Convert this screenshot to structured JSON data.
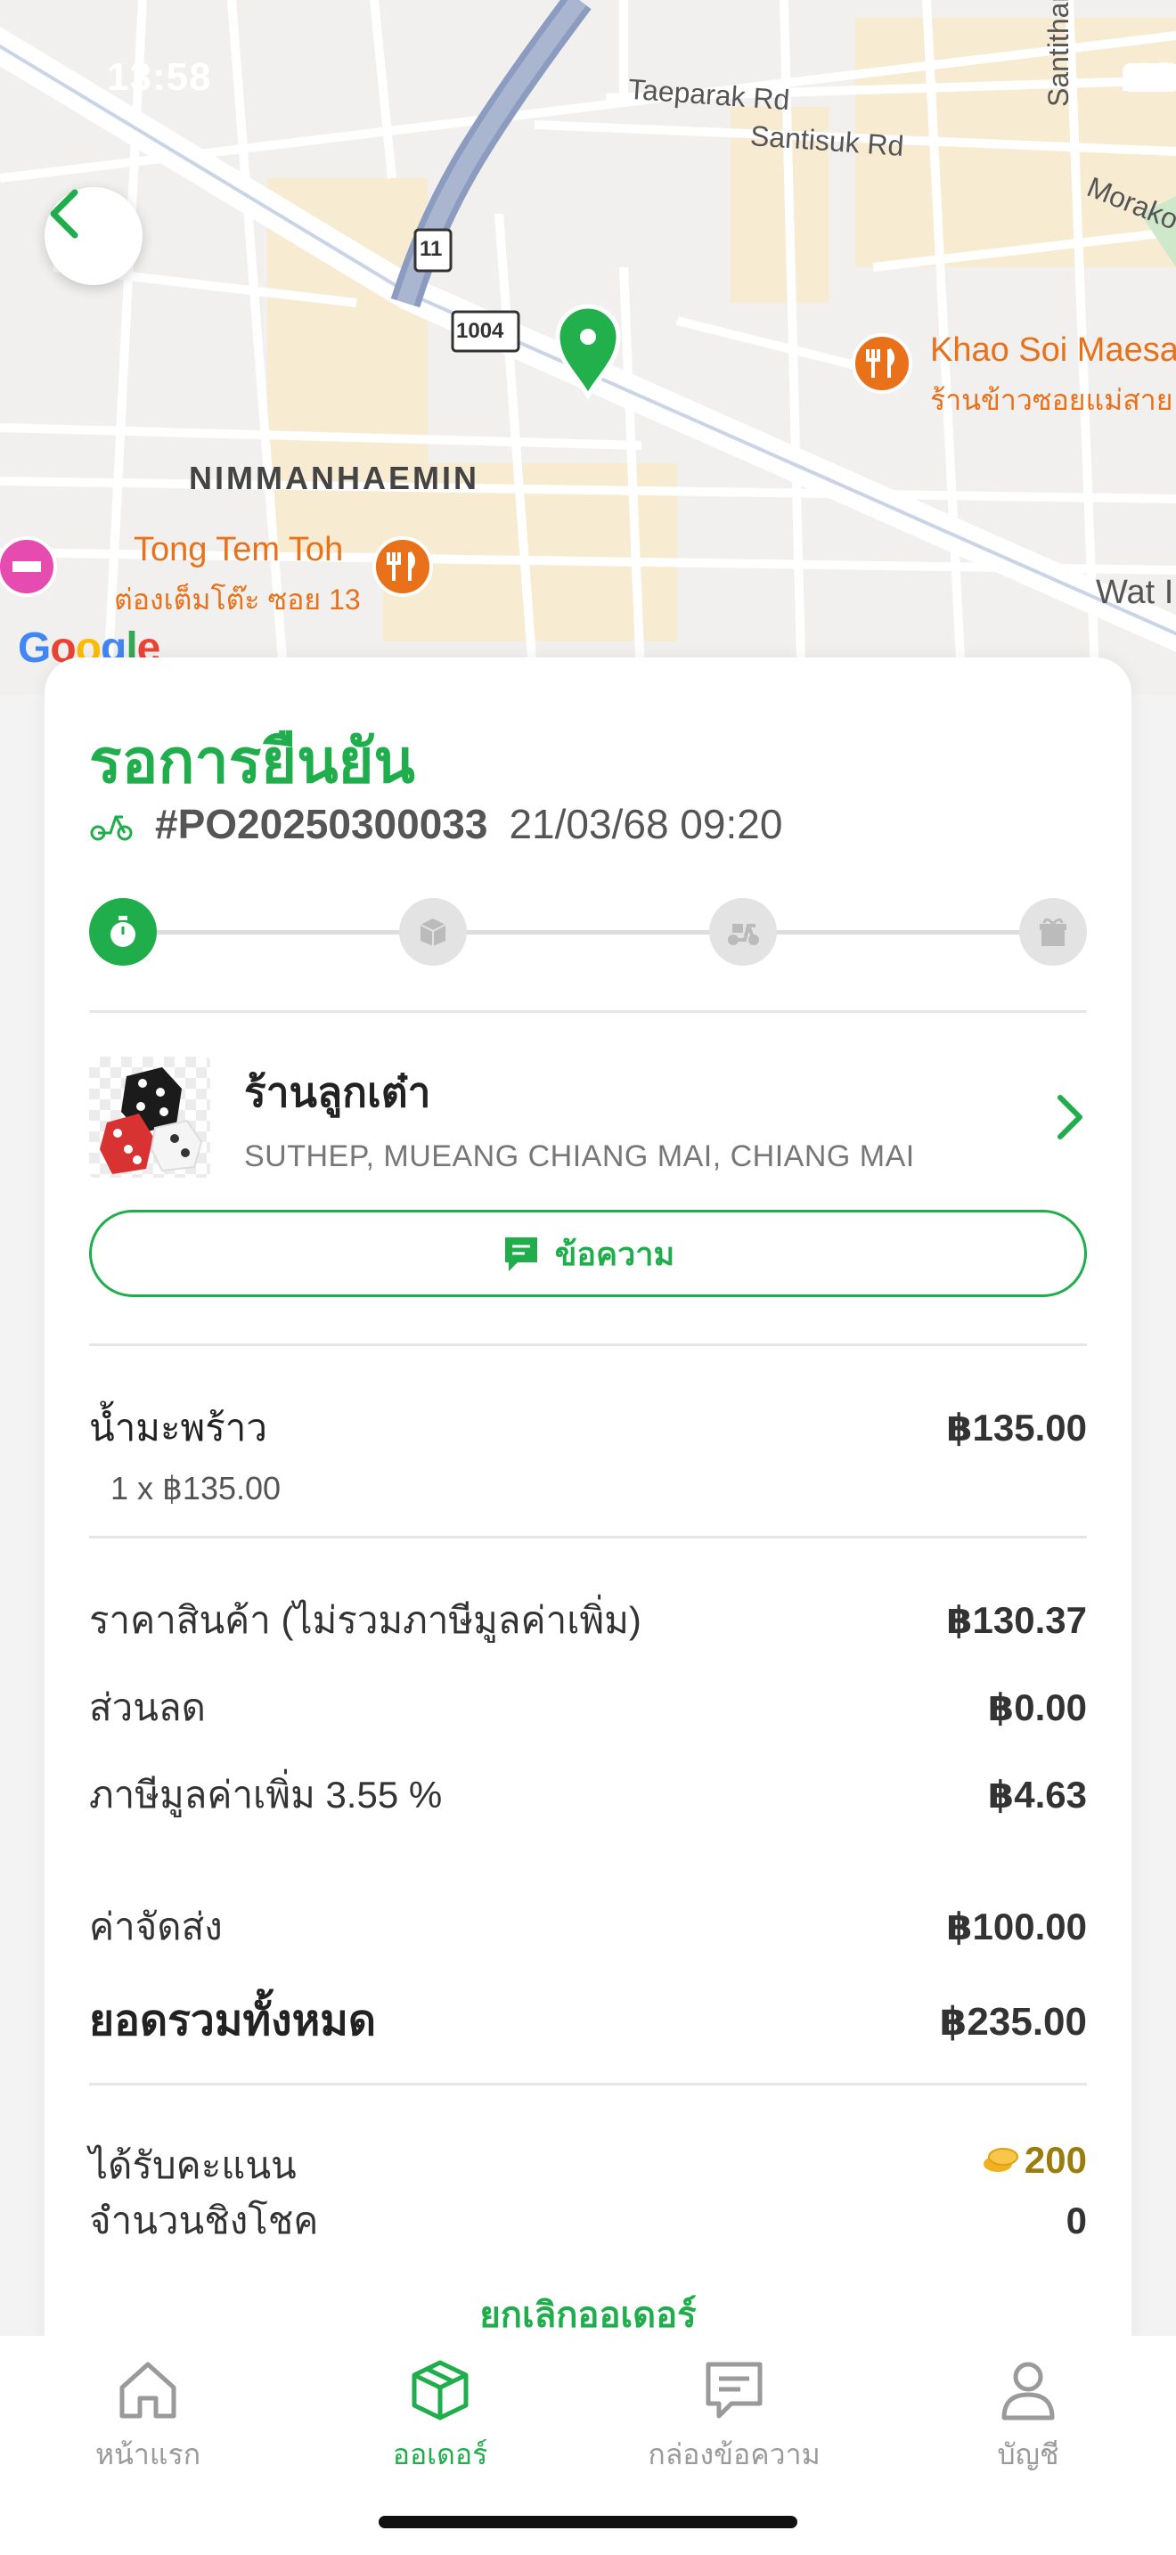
{
  "status_bar": {
    "time": "13:58"
  },
  "map": {
    "roads": [
      "Taeparak Rd",
      "Santisuk Rd",
      "Santitham R",
      "Morako"
    ],
    "route_badges": [
      "11",
      "1004"
    ],
    "area": "NIMMANHAEMIN",
    "pois": [
      {
        "name": "Khao Soi Maesa",
        "name_th": "ร้านข้าวซอยแม่สาย"
      },
      {
        "name": "Tong Tem Toh",
        "name_th": "ต่องเต็มโต๊ะ ซอย 13"
      },
      {
        "name": "Wat I"
      }
    ],
    "attribution": "Google",
    "colors": {
      "pin": "#21b04b",
      "poi": "#e8711a"
    }
  },
  "order": {
    "status": "รอการยืนยัน",
    "number": "#PO20250300033",
    "datetime": "21/03/68 09:20",
    "progress": {
      "steps": [
        "timer-icon",
        "box-icon",
        "delivery-scooter-icon",
        "gift-box-icon"
      ],
      "current_step": 1
    },
    "shop": {
      "name": "ร้านลูกเต๋า",
      "address": "SUTHEP, MUEANG CHIANG MAI, CHIANG MAI"
    },
    "message_button": "ข้อความ",
    "items": [
      {
        "name": "น้ำมะพร้าว",
        "qty_line": "1 x ฿135.00",
        "total": "฿135.00"
      }
    ],
    "summary": {
      "subtotal_label": "ราคาสินค้า (ไม่รวมภาษีมูลค่าเพิ่ม)",
      "subtotal": "฿130.37",
      "discount_label": "ส่วนลด",
      "discount": "฿0.00",
      "vat_label": "ภาษีมูลค่าเพิ่ม 3.55 %",
      "vat": "฿4.63",
      "shipping_label": "ค่าจัดส่ง",
      "shipping": "฿100.00",
      "total_label": "ยอดรวมทั้งหมด",
      "total": "฿235.00"
    },
    "rewards": {
      "points_label": "ได้รับคะแนน",
      "points": "200",
      "chances_label": "จำนวนชิงโชค",
      "chances": "0"
    },
    "cancel_label": "ยกเลิกออเดอร์",
    "accent_color": "#1fae4b"
  },
  "tabs": [
    {
      "label": "หน้าแรก",
      "icon": "home-icon"
    },
    {
      "label": "ออเดอร์",
      "icon": "package-icon",
      "active": true
    },
    {
      "label": "กล่องข้อความ",
      "icon": "message-icon"
    },
    {
      "label": "บัญชี",
      "icon": "user-icon"
    }
  ]
}
